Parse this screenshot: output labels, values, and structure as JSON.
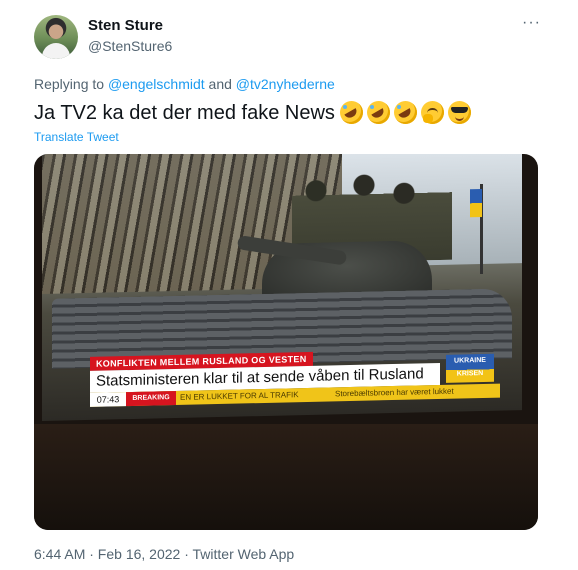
{
  "author": {
    "display_name": "Sten Sture",
    "handle": "@StenSture6"
  },
  "more_menu": "···",
  "reply": {
    "prefix": "Replying to",
    "user1": "@engelschmidt",
    "conjunction": "and",
    "user2": "@tv2nyhederne"
  },
  "tweet": {
    "text": "Ja TV2 ka det der med fake News",
    "emojis": [
      "rolling-on-floor-laughing",
      "rolling-on-floor-laughing",
      "rolling-on-floor-laughing",
      "thinking-face",
      "smiling-face-with-sunglasses"
    ],
    "translate_label": "Translate Tweet"
  },
  "tv_graphic": {
    "kicker": "KONFLIKTEN MELLEM RUSLAND OG VESTEN",
    "headline": "Statsministeren klar til at sende våben til Rusland",
    "badge": "UKRAINE KRISEN",
    "clock": "07:43",
    "breaking": "BREAKING",
    "ticker_1": "EN ER LUKKET FOR AL TRAFIK",
    "ticker_2": "Storebæltsbroen har været lukket"
  },
  "meta": {
    "time_date": "6:44 AM · Feb 16, 2022 · Twitter Web App"
  },
  "colors": {
    "link": "#1d9bf0",
    "secondary_text": "#536471",
    "tv_red": "#d6141f",
    "tv_yellow": "#f0c419"
  }
}
